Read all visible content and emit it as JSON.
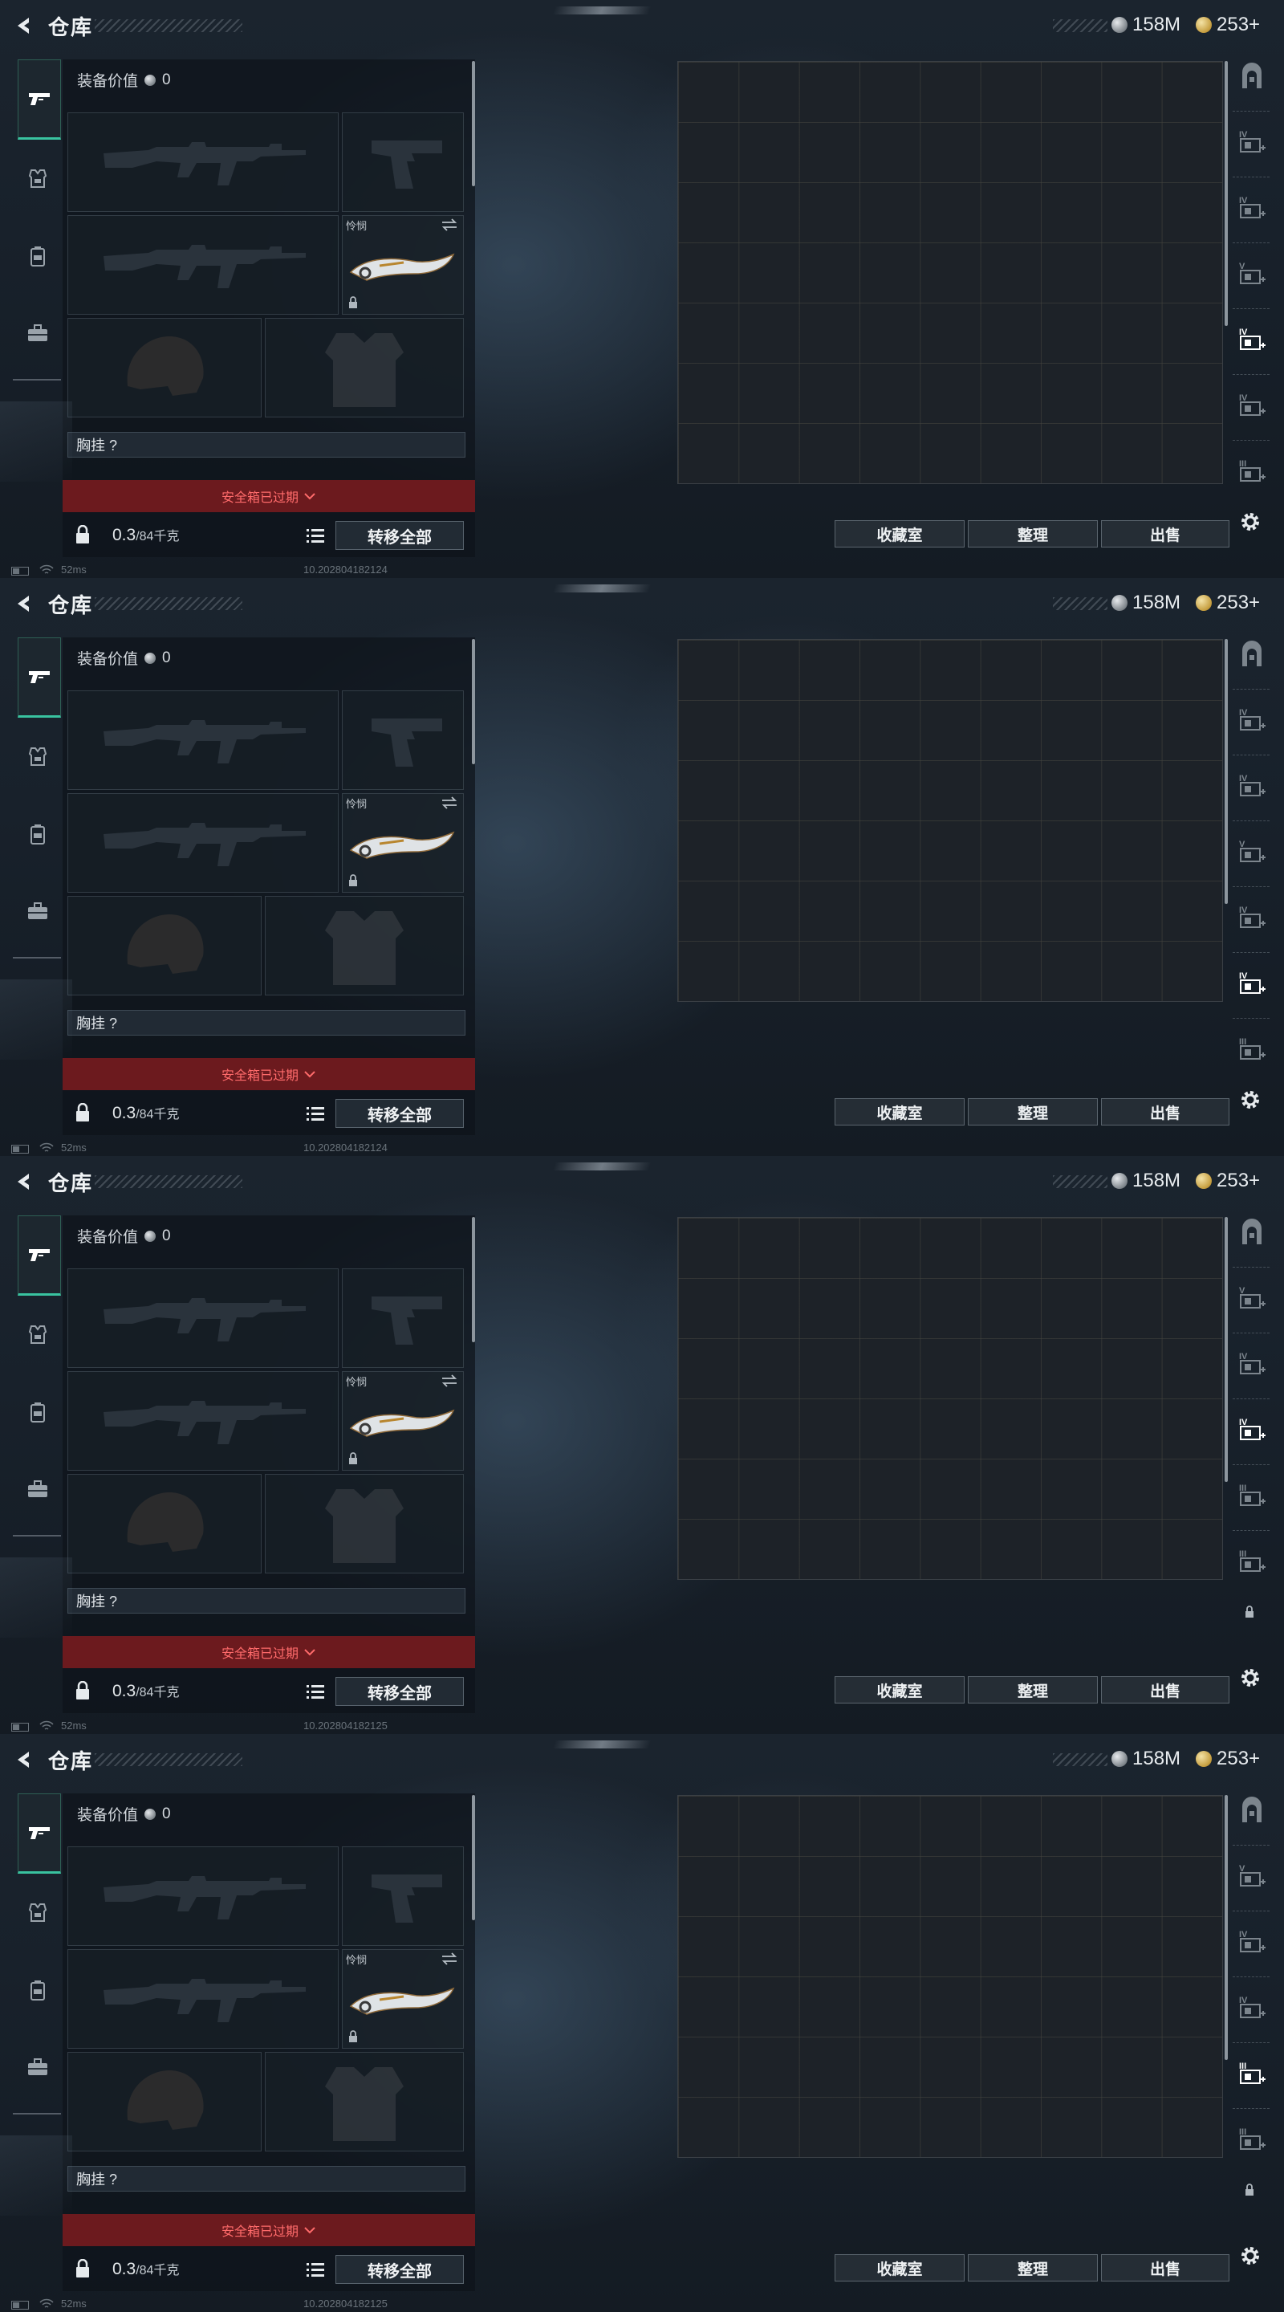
{
  "frames": [
    {
      "title": "仓库",
      "currency": {
        "silver": "158M",
        "gold": "253+"
      },
      "equip_value_label": "装备价值",
      "equip_value": "0",
      "melee_label": "怜悯",
      "chest_rig_label": "胸挂 ?",
      "safebox_text": "安全箱已过期",
      "weight": "0.3",
      "weight_max": "/84千克",
      "transfer_all": "转移全部",
      "buttons": {
        "collection": "收藏室",
        "organize": "整理",
        "sell": "出售"
      },
      "status": {
        "ping": "52ms",
        "version": "10.202804182124"
      },
      "grid_rows": 7,
      "grid_cols": 9,
      "right_rail": [
        "home-arch-icon",
        "upgrade-tier-iv-icon",
        "upgrade-tier-iv-icon",
        "upgrade-tier-v-icon",
        "upgrade-tier-iv-active-icon",
        "upgrade-tier-iv-icon",
        "upgrade-tier-iii-icon"
      ],
      "active_rail_index": 4,
      "rail_lock": false
    },
    {
      "title": "仓库",
      "currency": {
        "silver": "158M",
        "gold": "253+"
      },
      "equip_value_label": "装备价值",
      "equip_value": "0",
      "melee_label": "怜悯",
      "chest_rig_label": "胸挂 ?",
      "safebox_text": "安全箱已过期",
      "weight": "0.3",
      "weight_max": "/84千克",
      "transfer_all": "转移全部",
      "buttons": {
        "collection": "收藏室",
        "organize": "整理",
        "sell": "出售"
      },
      "status": {
        "ping": "52ms",
        "version": "10.202804182124"
      },
      "grid_rows": 6,
      "grid_cols": 9,
      "right_rail": [
        "home-arch-icon",
        "upgrade-tier-iv-icon",
        "upgrade-tier-iv-icon",
        "upgrade-tier-v-icon",
        "upgrade-tier-iv-icon",
        "upgrade-tier-iv-active-icon",
        "upgrade-tier-iii-icon"
      ],
      "active_rail_index": 5,
      "rail_lock": false
    },
    {
      "title": "仓库",
      "currency": {
        "silver": "158M",
        "gold": "253+"
      },
      "equip_value_label": "装备价值",
      "equip_value": "0",
      "melee_label": "怜悯",
      "chest_rig_label": "胸挂 ?",
      "safebox_text": "安全箱已过期",
      "weight": "0.3",
      "weight_max": "/84千克",
      "transfer_all": "转移全部",
      "buttons": {
        "collection": "收藏室",
        "organize": "整理",
        "sell": "出售"
      },
      "status": {
        "ping": "52ms",
        "version": "10.202804182125"
      },
      "grid_rows": 6,
      "grid_cols": 9,
      "right_rail": [
        "home-arch-icon",
        "upgrade-tier-v-icon",
        "upgrade-tier-iv-icon",
        "upgrade-tier-iv-active-icon",
        "upgrade-tier-iii-icon",
        "upgrade-tier-iii-icon"
      ],
      "active_rail_index": 3,
      "rail_lock": true
    },
    {
      "title": "仓库",
      "currency": {
        "silver": "158M",
        "gold": "253+"
      },
      "equip_value_label": "装备价值",
      "equip_value": "0",
      "melee_label": "怜悯",
      "chest_rig_label": "胸挂 ?",
      "safebox_text": "安全箱已过期",
      "weight": "0.3",
      "weight_max": "/84千克",
      "transfer_all": "转移全部",
      "buttons": {
        "collection": "收藏室",
        "organize": "整理",
        "sell": "出售"
      },
      "status": {
        "ping": "52ms",
        "version": "10.202804182125"
      },
      "grid_rows": 6,
      "grid_cols": 9,
      "right_rail": [
        "home-arch-icon",
        "upgrade-tier-v-icon",
        "upgrade-tier-iv-icon",
        "upgrade-tier-iv-icon",
        "upgrade-tier-iii-active-icon",
        "upgrade-tier-iii-icon"
      ],
      "active_rail_index": 4,
      "rail_lock": true
    }
  ]
}
